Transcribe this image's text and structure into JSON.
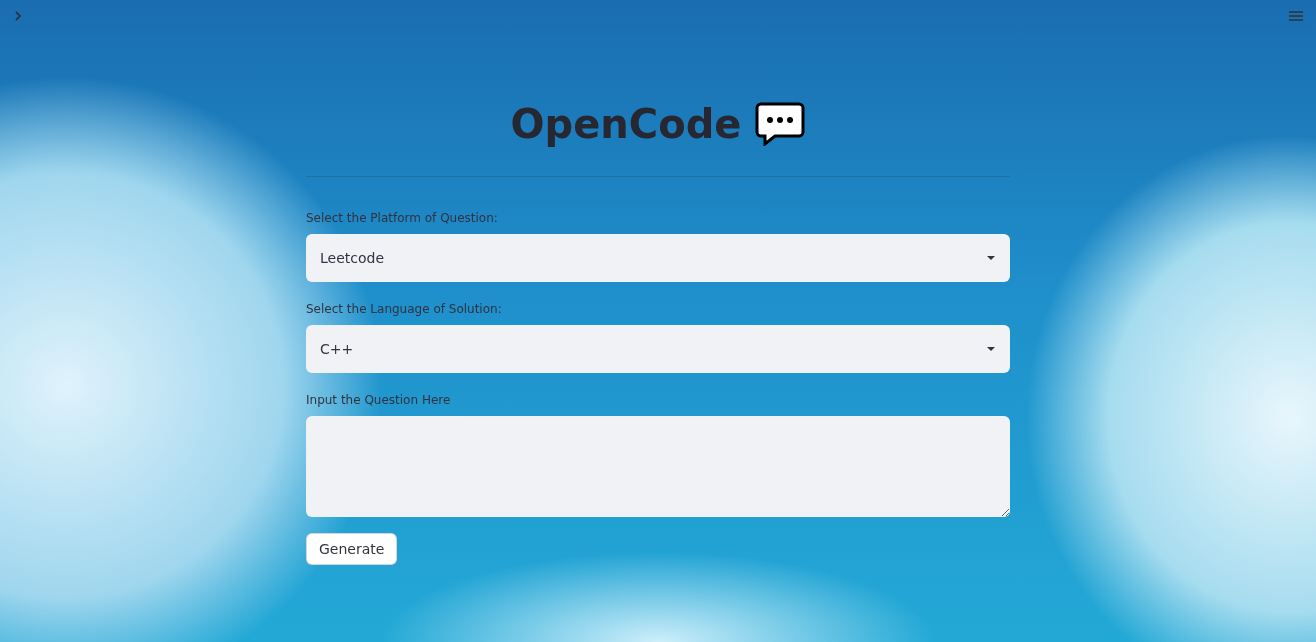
{
  "app": {
    "title": "OpenCode"
  },
  "fields": [
    {
      "kind": "select",
      "label": "Select the Platform of Question:",
      "value": "Leetcode"
    },
    {
      "kind": "select",
      "label": "Select the Language of Solution:",
      "value": "C++"
    },
    {
      "kind": "textarea",
      "label": "Input the Question Here"
    }
  ],
  "button": {
    "label": "Generate"
  }
}
